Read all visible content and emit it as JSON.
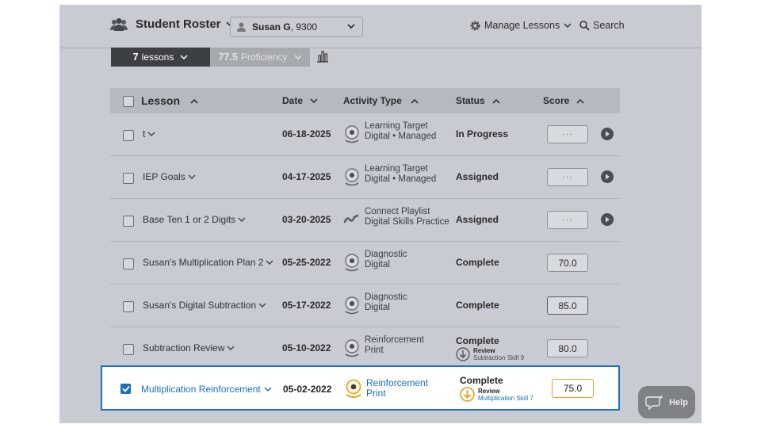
{
  "header": {
    "title": "Student Roster",
    "student_name": "Susan G",
    "student_id": ", 9300",
    "manage_label": "Manage Lessons",
    "search_label": "Search"
  },
  "toolbar": {
    "lessons_count": "7",
    "lessons_label": "lessons",
    "proficiency_value": "77.5",
    "proficiency_label": "Proficiency"
  },
  "table": {
    "columns": [
      "Lesson",
      "Date",
      "Activity Type",
      "Status",
      "Score"
    ],
    "rows": [
      {
        "lesson": "t",
        "date": "06-18-2025",
        "act1": "Learning Target",
        "act2": "Digital • Managed",
        "status": "In Progress",
        "score": "···",
        "icon": "target-icon"
      },
      {
        "lesson": "IEP Goals",
        "date": "04-17-2025",
        "act1": "Learning Target",
        "act2": "Digital • Managed",
        "status": "Assigned",
        "score": "···",
        "icon": "target-icon"
      },
      {
        "lesson": "Base Ten 1 or 2 Digits",
        "date": "03-20-2025",
        "act1": "Connect Playlist",
        "act2": "Digital Skills Practice",
        "status": "Assigned",
        "score": "···",
        "icon": "playlist-icon"
      },
      {
        "lesson": "Susan's Multiplication Plan 2",
        "date": "05-25-2022",
        "act1": "Diagnostic",
        "act2": "Digital",
        "status": "Complete",
        "score": "70.0",
        "icon": "target-icon"
      },
      {
        "lesson": "Susan's Digital Subtraction",
        "date": "05-17-2022",
        "act1": "Diagnostic",
        "act2": "Digital",
        "status": "Complete",
        "score": "85.0",
        "icon": "target-icon"
      },
      {
        "lesson": "Subtraction Review",
        "date": "05-10-2022",
        "act1": "Reinforcement",
        "act2": "Print",
        "status": "Complete",
        "review_label": "Review",
        "review_skill": "Subtraction Skill 9",
        "score": "80.0",
        "icon": "target-icon"
      }
    ],
    "selected_row": {
      "lesson": "Multiplication Reinforcement",
      "date": "05-02-2022",
      "act1": "Reinforcement",
      "act2": "Print",
      "status": "Complete",
      "review_label": "Review",
      "review_skill": "Multiplication Skill 7",
      "score": "75.0"
    }
  },
  "help": {
    "label": "Help"
  },
  "colors": {
    "accent": "#1a6fba",
    "highlight_border": "#1f6fc3",
    "score_selected_border": "#e5a329",
    "icon_orange": "#e5a329"
  }
}
